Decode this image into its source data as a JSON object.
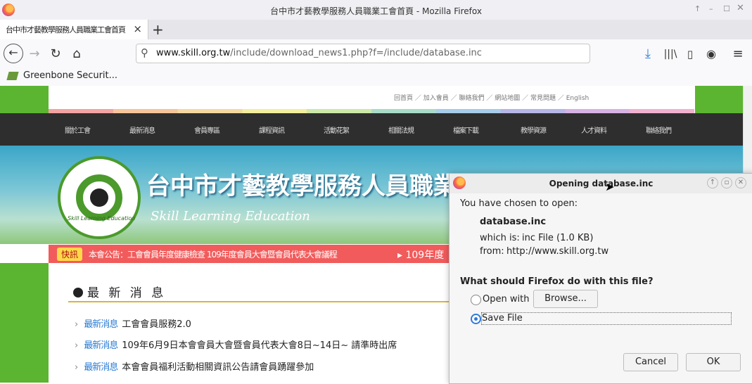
{
  "window": {
    "title": "台中市才藝教學服務人員職業工會首頁 - Mozilla Firefox"
  },
  "tab": {
    "title": "台中市才藝教學服務人員職業工會首頁",
    "close_glyph": "×",
    "new_tab_glyph": "+"
  },
  "toolbar": {
    "url_host": "www.skill.org.tw",
    "url_path": "/include/download_news1.php?f=/include/database.inc"
  },
  "bookmarks": [
    {
      "label": "Greenbone Securit..."
    }
  ],
  "page": {
    "site_title": "台中市才藝教學服務人員職業",
    "site_subtitle": "Skill Learning Education",
    "logo_text": "Skill Learning Education",
    "top_links": [
      "回首頁",
      "加入會員",
      "聯絡我們",
      "網站地圖",
      "常見問題",
      "English"
    ],
    "menu": [
      "關於工會",
      "最新消息",
      "會員專區",
      "課程資訊",
      "活動花絮",
      "相關法規",
      "檔案下載",
      "教學資源",
      "人才資料",
      "聯絡我們"
    ],
    "ticker_tag": "快訊",
    "ticker_text": "本會公告：工會會員年度健康檢查 109年度會員大會暨會員代表大會議程",
    "ticker_text2": "109年度",
    "news_heading": "最 新 消 息",
    "news": [
      {
        "tag": "最新消息",
        "text": "工會會員服務2.0"
      },
      {
        "tag": "最新消息",
        "text": "109年6月9日本會會員大會暨會員代表大會8日~14日~ 請準時出席"
      },
      {
        "tag": "最新消息",
        "text": "本會會員福利活動相關資訊公告請會員踴躍參加"
      }
    ]
  },
  "dialog": {
    "title": "Opening database.inc",
    "intro": "You have chosen to open:",
    "filename": "database.inc",
    "which_is_label": "which is:",
    "which_is_value": "inc File (1.0 KB)",
    "from_label": "from:",
    "from_value": "http://www.skill.org.tw",
    "question": "What should Firefox do with this file?",
    "open_with_label": "Open with",
    "browse_label": "Browse...",
    "save_file_label": "Save File",
    "cancel_label": "Cancel",
    "ok_label": "OK",
    "selected_option": "save_file"
  }
}
